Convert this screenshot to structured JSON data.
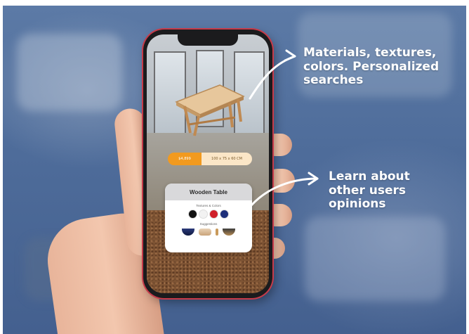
{
  "phone_screen": {
    "price_label": "$4,899",
    "size_label": "100 x 75 x 60 CM",
    "product_card": {
      "title": "Wooden Table",
      "colors_label": "Textures & Colors",
      "colors": [
        "#111111",
        "#f2f2f2",
        "#d0202a",
        "#1d2f7a"
      ],
      "suggestions_label": "Suggestions"
    }
  },
  "annotations": {
    "top": "Materials, textures, colors. Personalized searches",
    "bottom": "Learn about other users opinions"
  },
  "colors": {
    "background": "#4e6c9a",
    "accent_orange": "#f29a1f",
    "phone_frame_red": "#c63b4a"
  }
}
